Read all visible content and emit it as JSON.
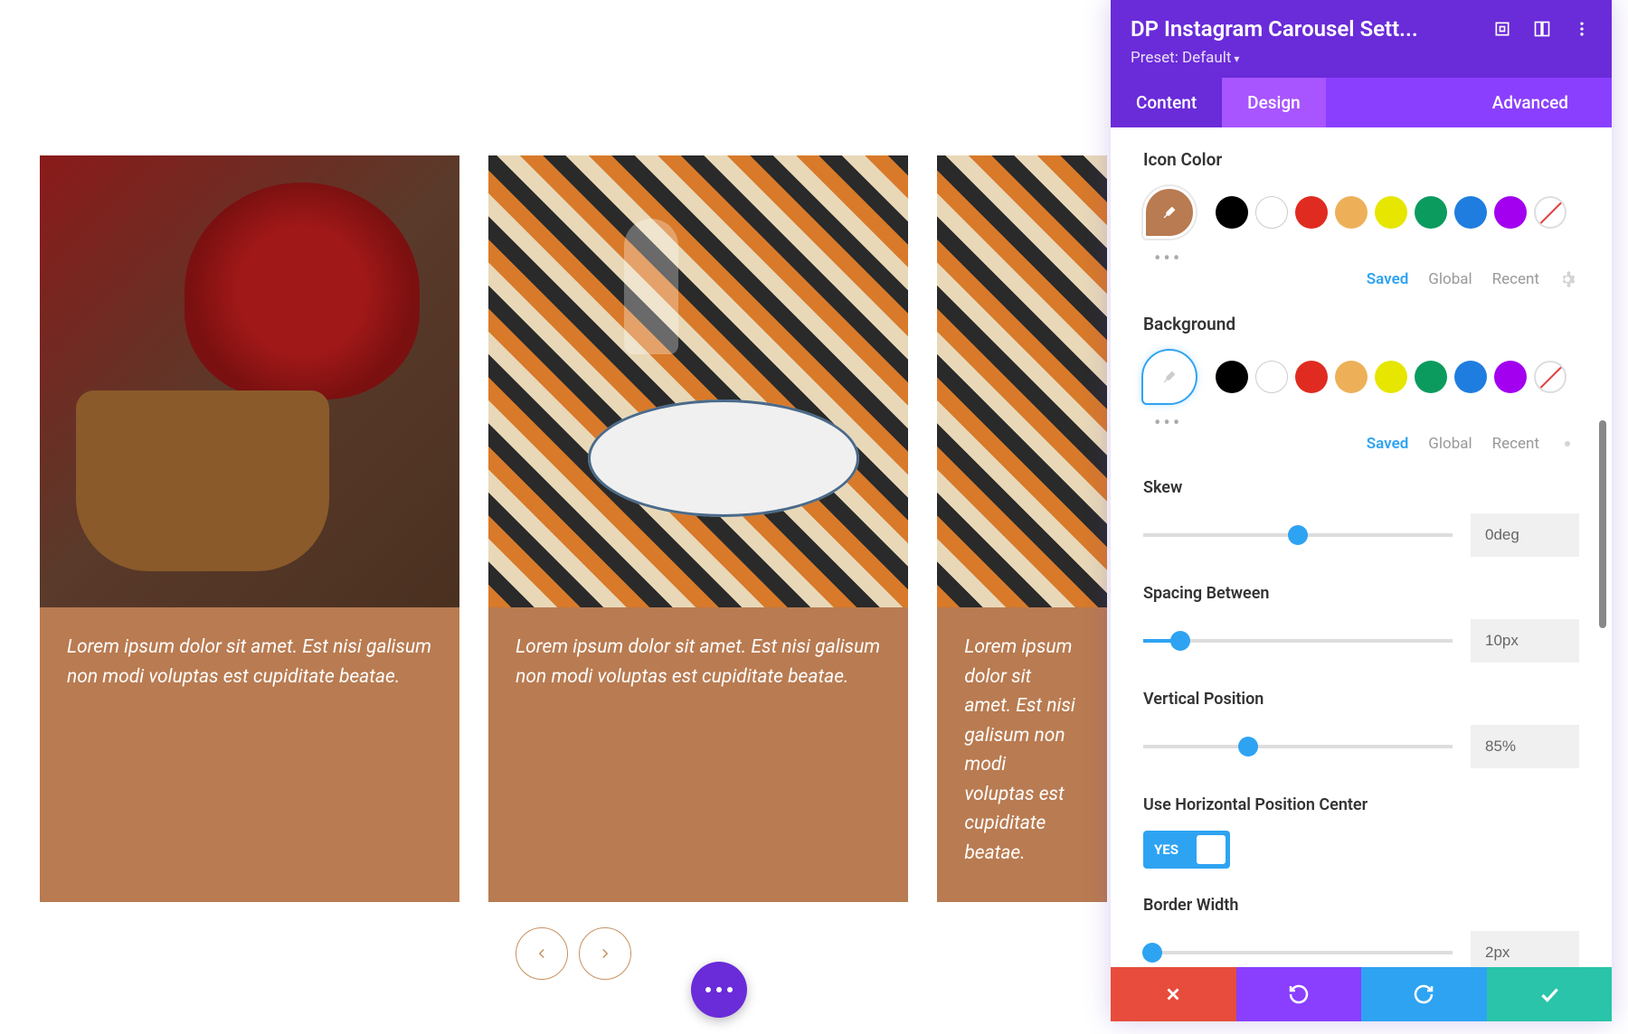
{
  "carousel": {
    "cards": [
      {
        "caption": "Lorem ipsum dolor sit amet. Est nisi galisum non modi voluptas est cupiditate beatae."
      },
      {
        "caption": "Lorem ipsum dolor sit amet. Est nisi galisum non modi voluptas est cupiditate beatae."
      },
      {
        "caption": "Lorem ipsum dolor sit amet. Est nisi galisum non modi voluptas est cupiditate beatae."
      }
    ]
  },
  "panel": {
    "title": "DP Instagram Carousel Sett...",
    "preset": "Preset: Default",
    "tabs": {
      "content": "Content",
      "design": "Design",
      "advanced": "Advanced"
    },
    "sections": {
      "icon_color_label": "Icon Color",
      "background_label": "Background",
      "palette_tabs": {
        "saved": "Saved",
        "global": "Global",
        "recent": "Recent"
      },
      "icon_palette": [
        "#000000",
        "#ffffff",
        "#e02b20",
        "#edb059",
        "#e6e600",
        "#0c9b5f",
        "#1f7de0",
        "#a300f0"
      ],
      "bg_palette": [
        "#000000",
        "#ffffff",
        "#e02b20",
        "#edb059",
        "#e6e600",
        "#0c9b5f",
        "#1f7de0",
        "#a300f0"
      ]
    },
    "controls": {
      "skew": {
        "label": "Skew",
        "value": "0deg",
        "percent": 50
      },
      "spacing": {
        "label": "Spacing Between",
        "value": "10px",
        "percent": 12
      },
      "vpos": {
        "label": "Vertical Position",
        "value": "85%",
        "percent": 34
      },
      "hcenter": {
        "label": "Use Horizontal Position Center",
        "value": "YES"
      },
      "border": {
        "label": "Border Width",
        "value": "2px",
        "percent": 3
      }
    }
  }
}
